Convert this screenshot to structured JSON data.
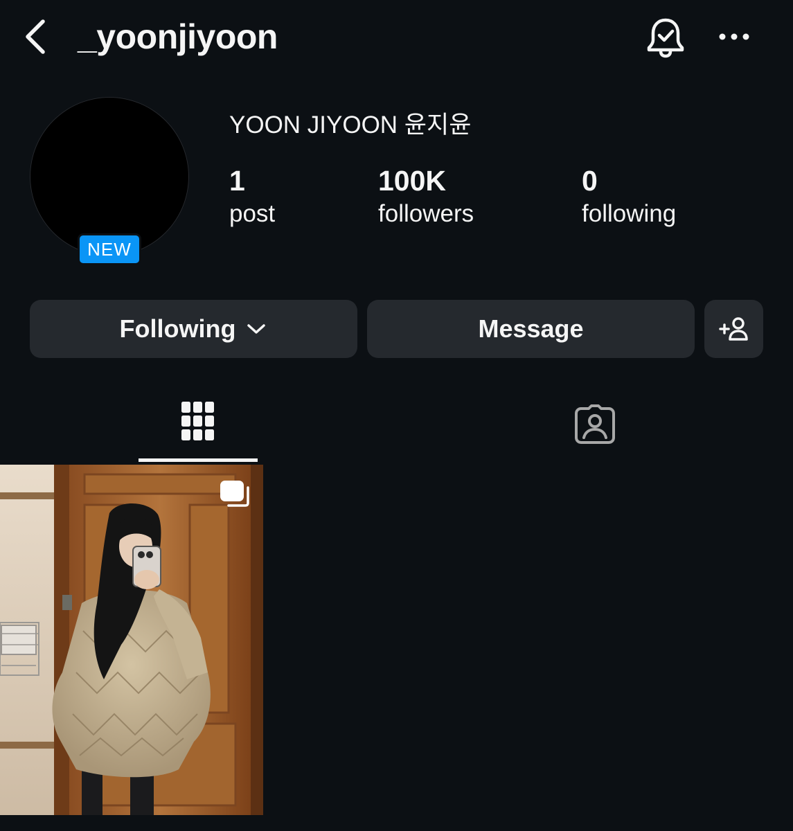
{
  "header": {
    "username": "_yoonjiyoon",
    "back_icon": "chevron-left-icon",
    "notification_icon": "bell-check-icon",
    "more_icon": "more-horizontal-icon"
  },
  "profile": {
    "badge": "NEW",
    "full_name": "YOON JIYOON 윤지윤",
    "stats": {
      "posts": {
        "value": "1",
        "label": "post"
      },
      "followers": {
        "value": "100K",
        "label": "followers"
      },
      "following": {
        "value": "0",
        "label": "following"
      }
    }
  },
  "actions": {
    "following_label": "Following",
    "message_label": "Message",
    "add_user_icon": "add-user-icon"
  },
  "tabs": [
    {
      "name": "posts",
      "icon": "grid-icon",
      "selected": true
    },
    {
      "name": "tagged",
      "icon": "tagged-person-icon",
      "selected": false
    }
  ],
  "posts": [
    {
      "type": "carousel",
      "icon": "multiple-posts-icon"
    }
  ],
  "colors": {
    "background": "#0c1014",
    "button": "#25292e",
    "badge": "#0a95f6",
    "text": "#f5f5f5"
  }
}
